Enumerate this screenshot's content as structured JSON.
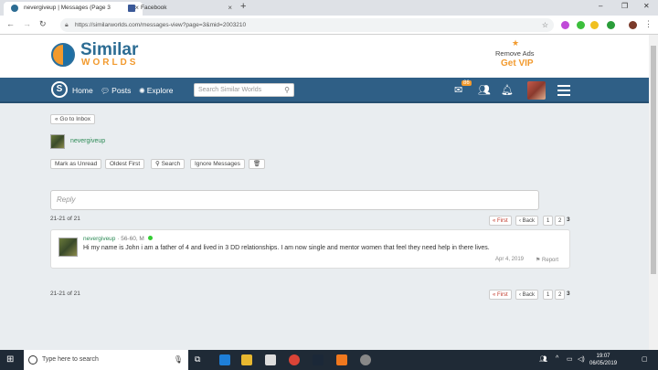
{
  "browser": {
    "tabs": [
      {
        "title": "nevergiveup | Messages (Page 3",
        "active": true,
        "favicon_color": "#2c6c93"
      },
      {
        "title": "Facebook",
        "active": false,
        "favicon_color": "#3b5998"
      }
    ],
    "new_tab": "+",
    "url": "https://similarworlds.com/messages-view?page=3&mid=2003210"
  },
  "site": {
    "logo_text": "Similar",
    "logo_subtext": "WORLDS",
    "remove_ads": "Remove Ads",
    "get_vip": "Get VIP",
    "nav": {
      "home": "Home",
      "posts": "Posts",
      "explore": "Explore",
      "search_placeholder": "Search Similar Worlds",
      "mail_badge": "86"
    }
  },
  "content": {
    "go_to_inbox": "« Go to Inbox",
    "username": "nevergiveup",
    "actions": {
      "mark_unread": "Mark as Unread",
      "oldest_first": "Oldest First",
      "search": "Search",
      "ignore": "Ignore Messages"
    },
    "reply_placeholder": "Reply",
    "count_label": "21-21 of 21",
    "pager": {
      "first": "« First",
      "back": "‹ Back",
      "pages": [
        "1",
        "2"
      ],
      "current": "3"
    },
    "message": {
      "username": "nevergiveup",
      "meta": " · 56-60, M",
      "text": "Hi my name is John i am a father of 4 and lived in 3 DD relationships. I am now single and mentor women that feel they need help in there lives.",
      "date": "Apr 4, 2019",
      "report": "Report"
    }
  },
  "taskbar": {
    "search_placeholder": "Type here to search",
    "time": "19:07",
    "date": "06/05/2019"
  },
  "colors": {
    "navbar": "#2f5f86",
    "accent_orange": "#f29a2e",
    "link_green": "#2e8b57"
  }
}
